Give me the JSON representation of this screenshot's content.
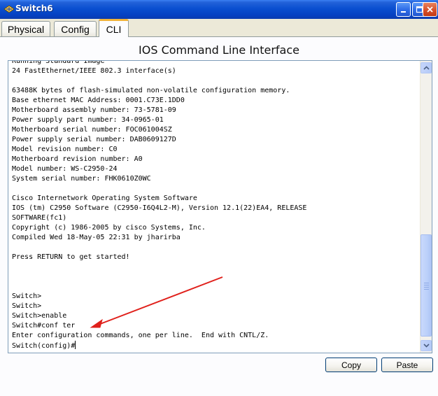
{
  "window": {
    "title": "Switch6",
    "icon": "network-switch-icon"
  },
  "tabs": [
    {
      "label": "Physical",
      "active": false
    },
    {
      "label": "Config",
      "active": false
    },
    {
      "label": "CLI",
      "active": true
    }
  ],
  "cli": {
    "heading": "IOS Command Line Interface",
    "lines": [
      "Running Standard Image",
      "24 FastEthernet/IEEE 802.3 interface(s)",
      "",
      "63488K bytes of flash-simulated non-volatile configuration memory.",
      "Base ethernet MAC Address: 0001.C73E.1DD0",
      "Motherboard assembly number: 73-5781-09",
      "Power supply part number: 34-0965-01",
      "Motherboard serial number: FOC061004SZ",
      "Power supply serial number: DAB0609127D",
      "Model revision number: C0",
      "Motherboard revision number: A0",
      "Model number: WS-C2950-24",
      "System serial number: FHK0610Z0WC",
      "",
      "Cisco Internetwork Operating System Software",
      "IOS (tm) C2950 Software (C2950-I6Q4L2-M), Version 12.1(22)EA4, RELEASE",
      "SOFTWARE(fc1)",
      "Copyright (c) 1986-2005 by cisco Systems, Inc.",
      "Compiled Wed 18-May-05 22:31 by jharirba",
      "",
      "Press RETURN to get started!",
      "",
      "",
      "",
      "Switch>",
      "Switch>",
      "Switch>enable",
      "Switch#conf ter",
      "Enter configuration commands, one per line.  End with CNTL/Z.",
      "Switch(config)#"
    ]
  },
  "buttons": {
    "copy_label": "Copy",
    "paste_label": "Paste"
  },
  "colors": {
    "titlebar": "#0a4fd0",
    "active_tab_accent": "#f1b33a",
    "annotation_arrow": "#e0201b"
  }
}
